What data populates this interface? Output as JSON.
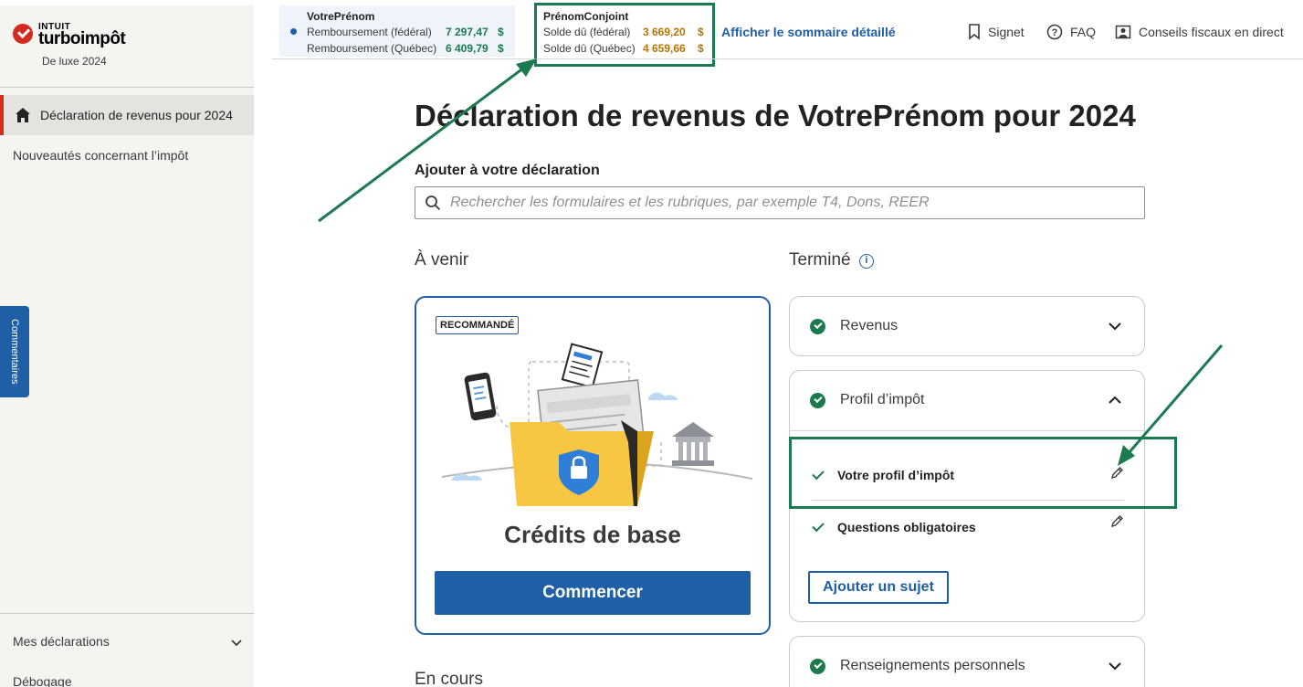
{
  "sidebar": {
    "logo": {
      "intuit": "INTUIT",
      "product": "turboimpôt",
      "edition": "De luxe 2024"
    },
    "active_item": "Déclaration de revenus pour 2024",
    "items": [
      "Nouveautés concernant l’impôt"
    ],
    "bottom_items": [
      "Mes déclarations",
      "Débogage"
    ],
    "feedback_tab": "Commentaires"
  },
  "summary": {
    "primary": {
      "name": "VotrePrénom",
      "rows": [
        {
          "label": "Remboursement (fédéral)",
          "amount": "7  297,47",
          "currency": "$"
        },
        {
          "label": "Remboursement (Québec)",
          "amount": "6  409,79",
          "currency": "$"
        }
      ],
      "color": "#1b7a50"
    },
    "spouse": {
      "name": "PrénomConjoint",
      "rows": [
        {
          "label": "Solde dû (fédéral)",
          "amount": "3  669,20",
          "currency": "$"
        },
        {
          "label": "Solde dû (Québec)",
          "amount": "4  659,66",
          "currency": "$"
        }
      ],
      "color": "#b87400"
    },
    "detail_link": "Afficher le sommaire détaillé"
  },
  "top_actions": {
    "bookmark": "Signet",
    "faq": "FAQ",
    "live_advice": "Conseils fiscaux en direct"
  },
  "main": {
    "title": "Déclaration de revenus de VotrePrénom pour 2024",
    "add_label": "Ajouter à votre déclaration",
    "search_placeholder": "Rechercher les formulaires et les rubriques, par exemple T4, Dons, REER",
    "upcoming_heading": "À venir",
    "done_heading": "Terminé",
    "in_progress_heading": "En cours",
    "recommended": {
      "badge": "RECOMMANDÉ",
      "title": "Crédits de base",
      "button": "Commencer"
    }
  },
  "completed": {
    "revenus": "Revenus",
    "profil": {
      "title": "Profil d’impôt",
      "items": [
        "Votre profil d’impôt",
        "Questions obligatoires"
      ],
      "add_topic": "Ajouter un sujet"
    },
    "renseignements": "Renseignements personnels"
  },
  "colors": {
    "brand_blue": "#1f5fa6",
    "success_green": "#1b7a50",
    "balance_due": "#b87400",
    "intuit_red": "#d52b1e"
  }
}
